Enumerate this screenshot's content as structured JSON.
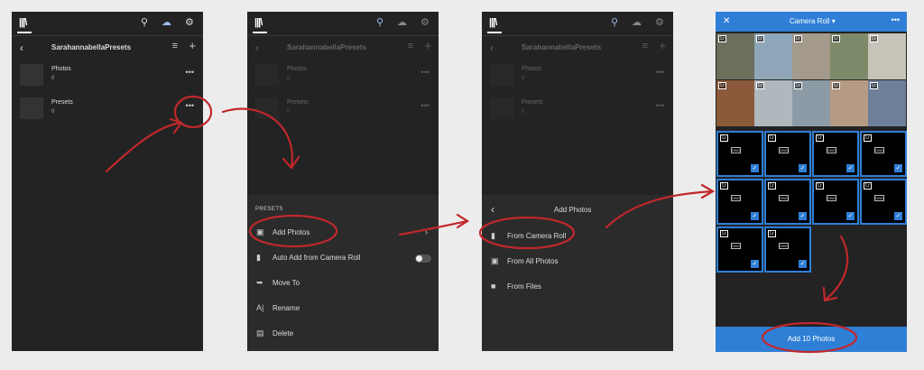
{
  "screen1": {
    "title": "SarahannabellaPresets",
    "albums": [
      {
        "name": "Photos",
        "count": "0"
      },
      {
        "name": "Presets",
        "count": "0"
      }
    ]
  },
  "screen2": {
    "title": "SarahannabellaPresets",
    "albums": [
      {
        "name": "Photos",
        "count": "0"
      },
      {
        "name": "Presets",
        "count": "0"
      }
    ],
    "sheet_header": "PRESETS",
    "menu": [
      {
        "label": "Add Photos",
        "icon": "add-photos-icon"
      },
      {
        "label": "Auto Add from Camera Roll",
        "icon": "auto-add-icon"
      },
      {
        "label": "Move To",
        "icon": "move-icon"
      },
      {
        "label": "Rename",
        "icon": "rename-icon"
      },
      {
        "label": "Delete",
        "icon": "trash-icon"
      }
    ]
  },
  "screen3": {
    "title": "SarahannabellaPresets",
    "albums": [
      {
        "name": "Photos",
        "count": "0"
      },
      {
        "name": "Presets",
        "count": "0"
      }
    ],
    "sheet_title": "Add Photos",
    "menu": [
      {
        "label": "From Camera Roll",
        "icon": "camera-roll-icon"
      },
      {
        "label": "From All Photos",
        "icon": "all-photos-icon"
      },
      {
        "label": "From Files",
        "icon": "folder-icon"
      }
    ]
  },
  "screen4": {
    "title": "Camera Roll",
    "badge": "Lr",
    "file_badge": "DNG",
    "add_button": "Add 10 Photos",
    "photo_colors": [
      "#6b6f5c",
      "#8fa7b9",
      "#a39a8c",
      "#7d8a6a",
      "#c8c3b8",
      "#8a5a3a",
      "#b0b8bd",
      "#8c9ba6",
      "#b59b83",
      "#6e8099"
    ]
  },
  "colors": {
    "accent": "#2f7fd7",
    "annotation": "#c0282c",
    "dark_bg": "#232323",
    "sheet_bg": "#2b2b2b"
  }
}
